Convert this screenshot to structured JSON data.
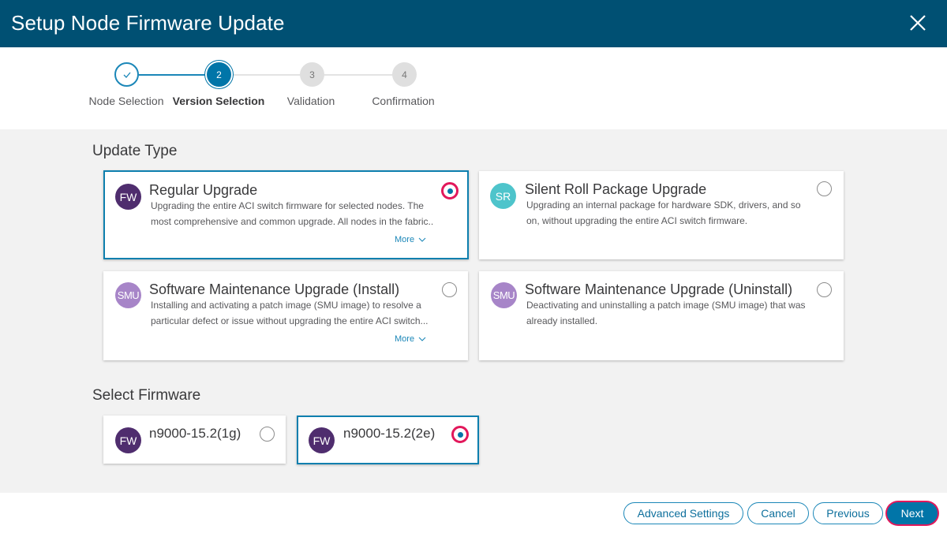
{
  "header": {
    "title": "Setup Node Firmware Update",
    "close_icon": "close-icon"
  },
  "stepper": {
    "steps": [
      {
        "number": "1",
        "label": "Node Selection",
        "state": "completed",
        "icon": "check-icon"
      },
      {
        "number": "2",
        "label": "Version Selection",
        "state": "active"
      },
      {
        "number": "3",
        "label": "Validation",
        "state": "pending"
      },
      {
        "number": "4",
        "label": "Confirmation",
        "state": "pending"
      }
    ]
  },
  "update_type": {
    "title": "Update Type",
    "options": [
      {
        "avatar": "FW",
        "avatar_color": "#4f2d6e",
        "title": "Regular Upgrade",
        "description": "Upgrading the entire ACI switch firmware for selected nodes. The most comprehensive and common upgrade. All nodes in the fabric..",
        "more_label": "More",
        "selected": true
      },
      {
        "avatar": "SR",
        "avatar_color": "#4ec4cb",
        "title": "Silent Roll Package Upgrade",
        "description": "Upgrading an internal package for hardware SDK, drivers, and so on, without upgrading the entire ACI switch firmware.",
        "selected": false
      },
      {
        "avatar": "SMU",
        "avatar_color": "#a785c8",
        "title": "Software Maintenance Upgrade (Install)",
        "description": "Installing and activating a patch image (SMU image) to resolve a particular defect or issue without upgrading the entire ACI switch...",
        "more_label": "More",
        "selected": false
      },
      {
        "avatar": "SMU",
        "avatar_color": "#a785c8",
        "title": "Software Maintenance Upgrade (Uninstall)",
        "description": "Deactivating and uninstalling a patch image (SMU image) that was already installed.",
        "selected": false
      }
    ]
  },
  "select_firmware": {
    "title": "Select Firmware",
    "options": [
      {
        "avatar": "FW",
        "avatar_color": "#4f2d6e",
        "label": "n9000-15.2(1g)",
        "selected": false
      },
      {
        "avatar": "FW",
        "avatar_color": "#4f2d6e",
        "label": "n9000-15.2(2e)",
        "selected": true
      }
    ]
  },
  "footer": {
    "advanced_settings_label": "Advanced Settings",
    "cancel_label": "Cancel",
    "previous_label": "Previous",
    "next_label": "Next"
  },
  "colors": {
    "header_bg": "#005073",
    "accent": "#0175a8",
    "focus_ring": "#e2185b"
  }
}
